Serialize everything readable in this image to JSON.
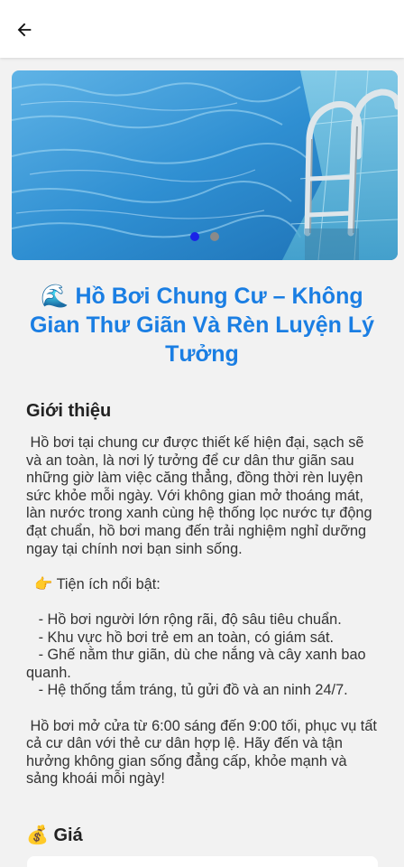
{
  "appbar": {
    "back_icon": "arrow-left-icon"
  },
  "banner": {
    "image": "swimming-pool-ladder-photo",
    "slide_count": 2,
    "active_slide": 1,
    "colors": {
      "active_dot": "#1a22e8",
      "inactive_dot": "#8a8a8a"
    }
  },
  "title": {
    "icon": "🌊",
    "text": "Hồ Bơi Chung Cư – Không Gian Thư Giãn Và Rèn Luyện Lý Tưởng"
  },
  "intro": {
    "heading": "Giới thiệu",
    "body": " Hồ bơi tại chung cư được thiết kế hiện đại, sạch sẽ và an toàn, là nơi lý tưởng để cư dân thư giãn sau những giờ làm việc căng thẳng, đồng thời rèn luyện sức khỏe mỗi ngày. Với không gian mở thoáng mát, làn nước trong xanh cùng hệ thống lọc nước tự động đạt chuẩn, hồ bơi mang đến trải nghiệm nghỉ dưỡng ngay tại chính nơi bạn sinh sống.\n\n  👉 Tiện ích nổi bật:\n\n   - Hồ bơi người lớn rộng rãi, độ sâu tiêu chuẩn.\n   - Khu vực hồ bơi trẻ em an toàn, có giám sát.\n   - Ghế nằm thư giãn, dù che nắng và cây xanh bao quanh.\n   - Hệ thống tắm tráng, tủ gửi đồ và an ninh 24/7.\n\n Hồ bơi mở cửa từ 6:00 sáng đến 9:00 tối, phục vụ tất cả cư dân với thẻ cư dân hợp lệ. Hãy đến và tận hưởng không gian sống đẳng cấp, khỏe mạnh và sảng khoái mỗi ngày!"
  },
  "price": {
    "icon": "💰",
    "heading": "Giá"
  },
  "colors": {
    "title": "#1a7ee3",
    "background": "#f2f2f2"
  }
}
